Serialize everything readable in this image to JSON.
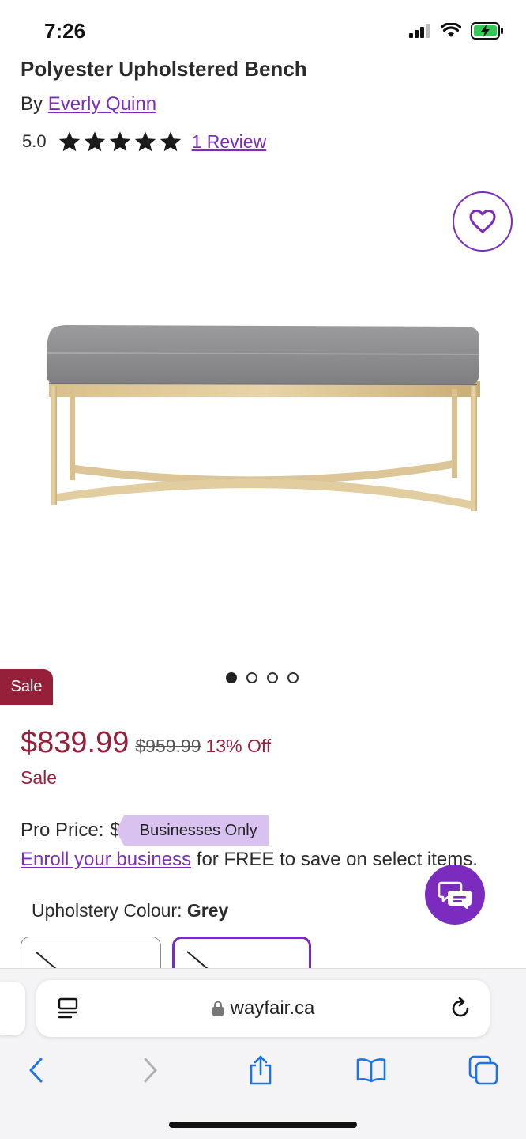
{
  "status_bar": {
    "time": "7:26"
  },
  "product": {
    "title": "Polyester Upholstered Bench",
    "brand_prefix": "By",
    "brand": "Everly Quinn",
    "rating": "5.0",
    "rating_value": 5,
    "rating_max": 5,
    "review_link": "1 Review"
  },
  "gallery": {
    "image_count": 4,
    "active_index": 0
  },
  "badge": {
    "sale": "Sale"
  },
  "pricing": {
    "current": "$839.99",
    "was": "$959.99",
    "off": "13% Off",
    "sale_label": "Sale",
    "pro_price_label": "Pro Price:",
    "pro_price_value": "$",
    "business_tag": "Businesses Only",
    "enroll_link": "Enroll your business",
    "enroll_rest": " for FREE to save on select items."
  },
  "options": {
    "colour_label": "Upholstery Colour:",
    "colour_value": "Grey"
  },
  "browser": {
    "url": "wayfair.ca"
  },
  "colors": {
    "accent": "#7b2cbf",
    "sale": "#96203a",
    "tag": "#d9c2f0"
  },
  "icons": {
    "favorite": "heart-icon",
    "chat": "chat-bubbles-icon",
    "reader": "reader-icon",
    "lock": "lock-icon",
    "reload": "reload-icon",
    "back": "back-icon",
    "forward": "forward-icon",
    "share": "share-icon",
    "bookmarks": "bookmarks-icon",
    "tabs": "tabs-icon"
  }
}
